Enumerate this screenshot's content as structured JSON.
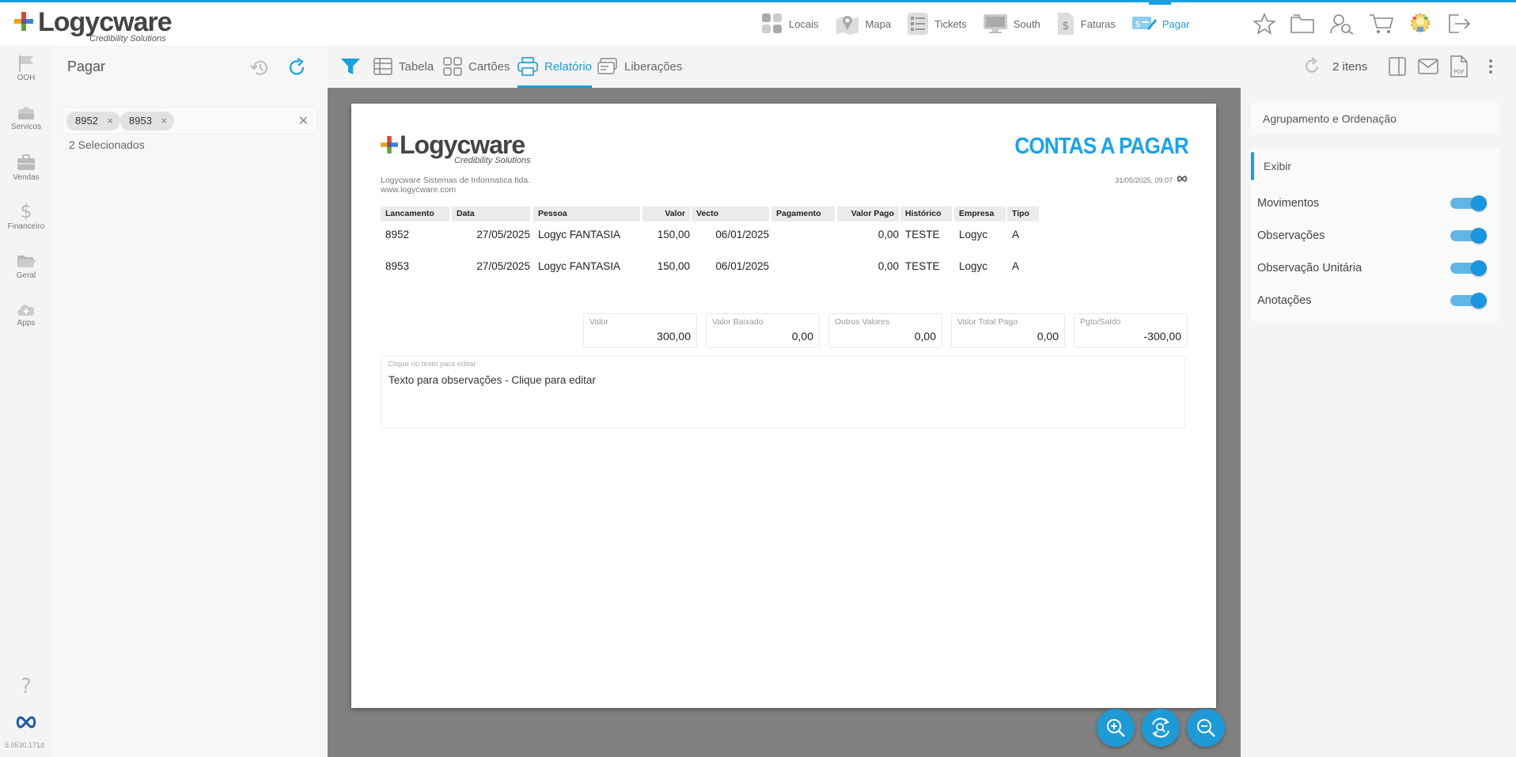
{
  "app": {
    "logo_text": "Logycware",
    "logo_tagline": "Credibility Solutions",
    "version": "5.0530.171d"
  },
  "colors": {
    "accent": "#1a9ee0",
    "report_title": "#1ba3e8",
    "toggle_on": "#1a96de"
  },
  "topnav": [
    {
      "label": "Locais",
      "icon": "grid-apps-icon"
    },
    {
      "label": "Mapa",
      "icon": "map-pin-icon"
    },
    {
      "label": "Tickets",
      "icon": "checklist-icon"
    },
    {
      "label": "South",
      "icon": "monitor-icon"
    },
    {
      "label": "Faturas",
      "icon": "invoice-dollar-icon"
    },
    {
      "label": "Pagar",
      "icon": "payment-icon",
      "active": true
    }
  ],
  "top_icons": [
    "star-icon",
    "folder-icon",
    "user-search-icon",
    "cart-icon",
    "lightbulb-gear-icon",
    "logout-icon"
  ],
  "sidebar": {
    "items": [
      {
        "label": "OOH",
        "icon": "flag-icon"
      },
      {
        "label": "Servicos",
        "icon": "services-icon"
      },
      {
        "label": "Vendas",
        "icon": "briefcase-icon"
      },
      {
        "label": "Financeiro",
        "icon": "dollar-icon"
      },
      {
        "label": "Geral",
        "icon": "folder-open-icon"
      },
      {
        "label": "Apps",
        "icon": "cloud-add-icon"
      }
    ],
    "help_icon": "question-icon",
    "brand_icon": "infinity-icon"
  },
  "leftpanel": {
    "title": "Pagar",
    "chips": [
      "8952",
      "8953"
    ],
    "chip_remove": "×",
    "clear_symbol": "✕",
    "selected_count": "2 Selecionados"
  },
  "toolbar": {
    "tabs": [
      {
        "label": "Tabela",
        "icon": "table-icon"
      },
      {
        "label": "Cartões",
        "icon": "cards-icon"
      },
      {
        "label": "Relatório",
        "icon": "printer-icon",
        "active": true
      },
      {
        "label": "Liberações",
        "icon": "release-icon"
      }
    ],
    "count": "2 itens"
  },
  "report": {
    "title": "CONTAS A PAGAR",
    "company": "Logycware Sistemas de Informatica ltda.",
    "website": "www.logycware.com",
    "datetime": "31/05/2025, 09:07",
    "headers": [
      "Lancamento",
      "Data",
      "Pessoa",
      "Valor",
      "Vecto",
      "Pagamento",
      "Valor Pago",
      "Histórico",
      "Empresa",
      "Tipo"
    ],
    "rows": [
      {
        "lancamento": "8952",
        "data": "27/05/2025",
        "pessoa": "Logyc FANTASIA",
        "valor": "150,00",
        "vecto": "06/01/2025",
        "pagamento": "",
        "valor_pago": "0,00",
        "historico": "TESTE",
        "empresa": "Logyc",
        "tipo": "A"
      },
      {
        "lancamento": "8953",
        "data": "27/05/2025",
        "pessoa": "Logyc FANTASIA",
        "valor": "150,00",
        "vecto": "06/01/2025",
        "pagamento": "",
        "valor_pago": "0,00",
        "historico": "TESTE",
        "empresa": "Logyc",
        "tipo": "A"
      }
    ],
    "totals": [
      {
        "label": "Valor",
        "value": "300,00"
      },
      {
        "label": "Valor Baixado",
        "value": "0,00"
      },
      {
        "label": "Outros Valores",
        "value": "0,00"
      },
      {
        "label": "Valor Total Pago",
        "value": "0,00"
      },
      {
        "label": "Pgto/Saldo",
        "value": "-300,00"
      }
    ],
    "notes_hint": "Clique no texto para editar",
    "notes_text": "Texto para observações - Clique para editar"
  },
  "rightpanel": {
    "group_label": "Agrupamento e Ordenação",
    "section_label": "Exibir",
    "toggles": [
      {
        "label": "Movimentos",
        "on": true
      },
      {
        "label": "Observações",
        "on": true
      },
      {
        "label": "Observação Unitária",
        "on": true
      },
      {
        "label": "Anotações",
        "on": true
      }
    ]
  }
}
